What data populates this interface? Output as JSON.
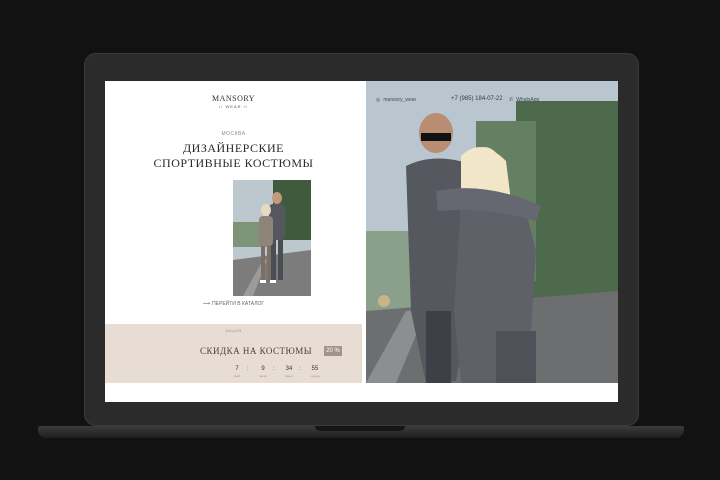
{
  "brand": {
    "name": "MANSORY",
    "sub": "// WEAR //"
  },
  "hero": {
    "city": "МОСКВА",
    "title_line1": "ДИЗАЙНЕРСКИЕ",
    "title_line2": "СПОРТИВНЫЕ КОСТЮМЫ",
    "catalog_link": "ПЕРЕЙТИ В КАТАЛОГ"
  },
  "promo": {
    "label": "АКЦИЯ",
    "title": "СКИДКА НА КОСТЮМЫ",
    "badge": "20 %",
    "timer": {
      "days": "7",
      "hours": "9",
      "minutes": "34",
      "seconds": "55",
      "days_label": "дней",
      "hours_label": "часов",
      "minutes_label": "минут",
      "seconds_label": "секунд"
    }
  },
  "contacts": {
    "instagram": "mansory_wear",
    "phone": "+7 (985) 184-07-22",
    "whatsapp": "WhatsApp"
  },
  "colors": {
    "accent_beige": "#e8ddd3",
    "badge": "#a0958a",
    "background": "#121212"
  },
  "icons": {
    "instagram": "instagram-icon",
    "whatsapp": "whatsapp-icon",
    "arrow": "arrow-right-icon"
  }
}
